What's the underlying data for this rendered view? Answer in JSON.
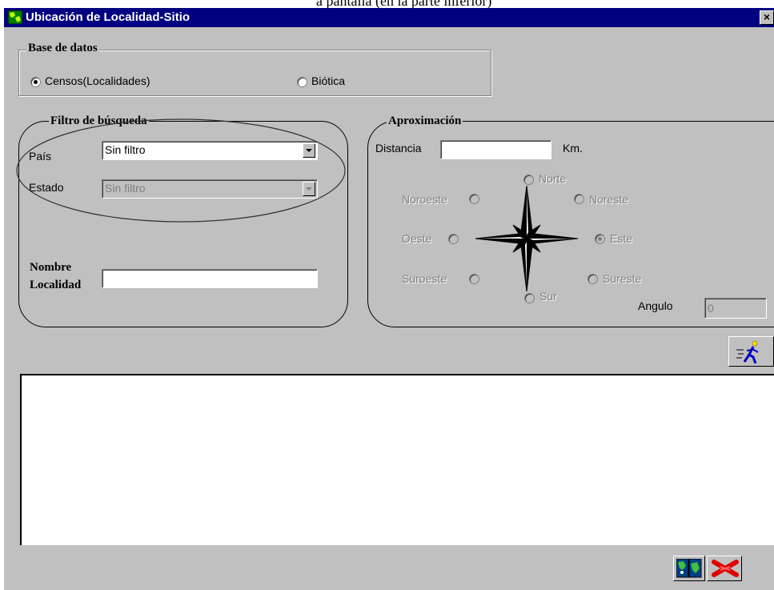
{
  "caption_fragment": "a pantalla (en la parte inferior)",
  "window": {
    "title": "Ubicación de Localidad-Sitio",
    "close_glyph": "×",
    "icon": "app-map-icon"
  },
  "database_group": {
    "legend": "Base de datos",
    "options": [
      {
        "label": "Censos(Localidades)",
        "checked": true
      },
      {
        "label": "Biótica",
        "checked": false
      }
    ]
  },
  "filter_group": {
    "legend": "Filtro de búsqueda",
    "pais": {
      "label": "País",
      "value": "Sin filtro"
    },
    "estado": {
      "label": "Estado",
      "value": "Sin filtro",
      "disabled": true
    },
    "nombre": {
      "label_line1": "Nombre",
      "label_line2": "Localidad",
      "value": ""
    }
  },
  "approx_group": {
    "legend": "Aproximación",
    "distancia": {
      "label": "Distancia",
      "value": "",
      "unit": "Km."
    },
    "directions": {
      "norte": "Norte",
      "noroeste": "Noroeste",
      "noreste": "Noreste",
      "oeste": "Oeste",
      "este": "Este",
      "suroeste": "Suroeste",
      "sureste": "Sureste",
      "sur": "Sur"
    },
    "selected_direction": "Este",
    "angulo": {
      "label": "Angulo",
      "value": "0"
    }
  },
  "icons": {
    "search_button": "runner-search-icon",
    "map_button": "map-icon",
    "close_button": "red-x-icon",
    "compass": "compass-rose-icon"
  },
  "colors": {
    "titlebar": "#000080",
    "face": "#c0c0c0",
    "disabled_text": "#808080",
    "close_red": "#e00000"
  }
}
